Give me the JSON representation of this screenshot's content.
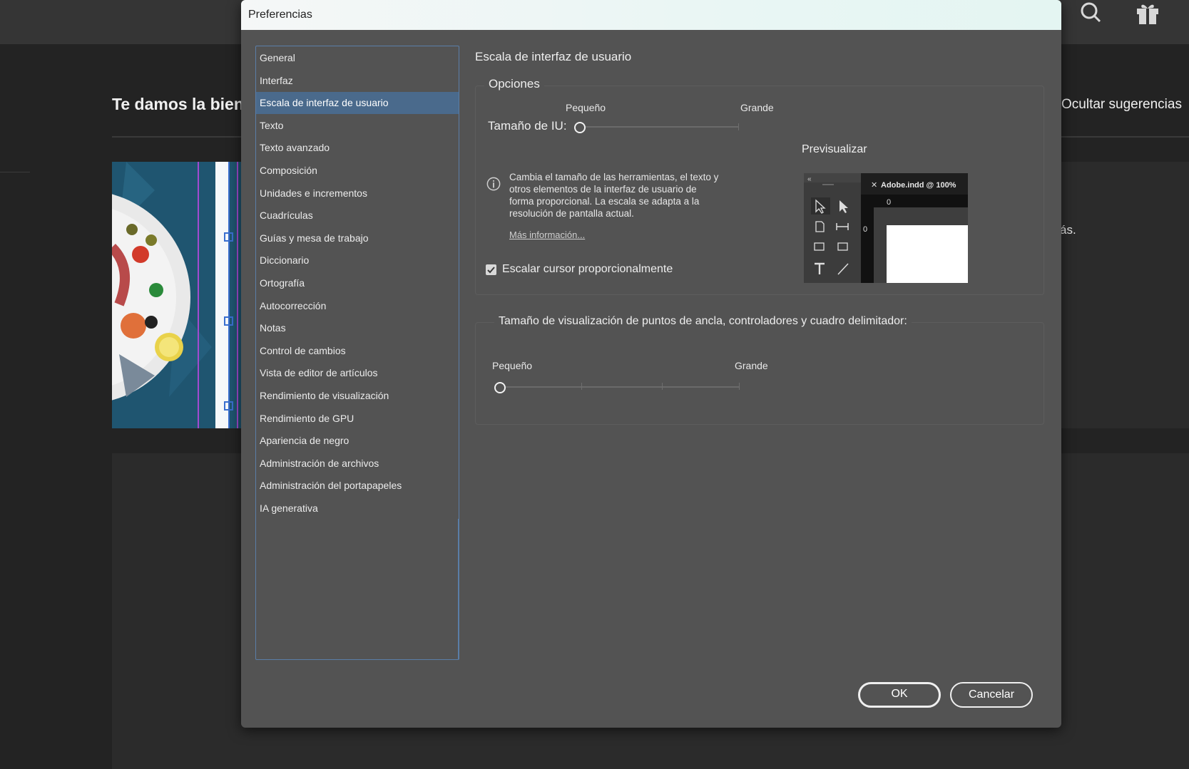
{
  "background": {
    "welcome_title": "Te damos la bienve",
    "hide_suggestions": "Ocultar sugerencias",
    "more_text": "ás."
  },
  "dialog": {
    "title": "Preferencias",
    "nav": [
      "General",
      "Interfaz",
      "Escala de interfaz de usuario",
      "Texto",
      "Texto avanzado",
      "Composición",
      "Unidades e incrementos",
      "Cuadrículas",
      "Guías y mesa de trabajo",
      "Diccionario",
      "Ortografía",
      "Autocorrección",
      "Notas",
      "Control de cambios",
      "Vista de editor de artículos",
      "Rendimiento de visualización",
      "Rendimiento de GPU",
      "Apariencia de negro",
      "Administración de archivos",
      "Administración del portapapeles",
      "IA generativa"
    ],
    "selected_index": 2,
    "section_title": "Escala de interfaz de usuario",
    "options_group": {
      "title": "Opciones",
      "small_label": "Pequeño",
      "large_label": "Grande",
      "ui_size_label": "Tamaño de IU:",
      "ui_size_value": 0,
      "preview_label": "Previsualizar",
      "description": "Cambia el tamaño de las herramientas, el texto y otros elementos de la interfaz de usuario de forma proporcional. La escala se adapta a la resolución de pantalla actual.",
      "more_info_link": "Más información...",
      "scale_cursor_label": "Escalar cursor proporcionalmente",
      "scale_cursor_checked": true
    },
    "anchor_group": {
      "title": "Tamaño de visualización de puntos de ancla, controladores y cuadro delimitador:",
      "small_label": "Pequeño",
      "large_label": "Grande",
      "value": 0
    },
    "preview": {
      "tab_label": "Adobe.indd @ 100%",
      "collapse": "«",
      "ruler_zero_h": "0",
      "ruler_zero_v": "0"
    },
    "ok_label": "OK",
    "cancel_label": "Cancelar"
  }
}
